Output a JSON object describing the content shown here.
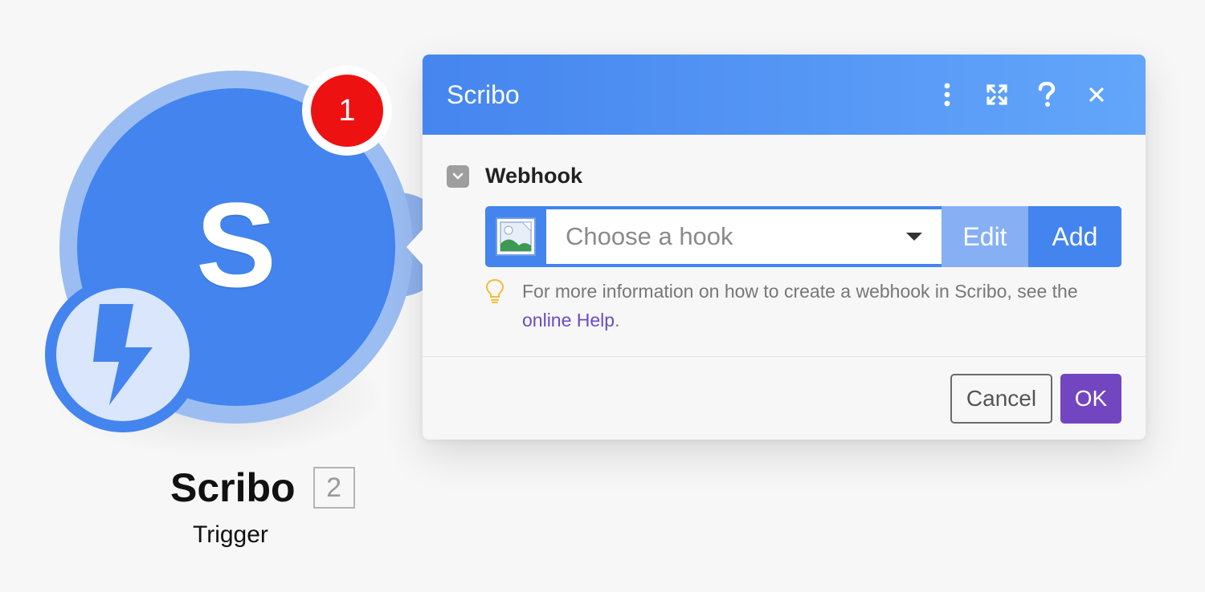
{
  "module": {
    "letter": "S",
    "badge_count": "1",
    "title": "Scribo",
    "id": "2",
    "subtitle": "Trigger",
    "type_icon": "lightning-bolt-icon",
    "colors": {
      "primary": "#4384ef",
      "ring": "#9bbdf2",
      "badge": "#ee1111"
    }
  },
  "dialog": {
    "title": "Scribo",
    "header_icons": [
      "more-vertical-icon",
      "expand-icon",
      "help-icon",
      "close-icon"
    ],
    "field": {
      "label": "Webhook",
      "select_placeholder": "Choose a hook",
      "edit_label": "Edit",
      "add_label": "Add",
      "help_prefix": "For more information on how to create a webhook in Scribo, see the ",
      "help_link": "online Help",
      "help_suffix": "."
    },
    "footer": {
      "cancel_label": "Cancel",
      "ok_label": "OK"
    },
    "colors": {
      "header": "#4585ee",
      "ok": "#7246c0",
      "link": "#6b4cc6"
    }
  }
}
